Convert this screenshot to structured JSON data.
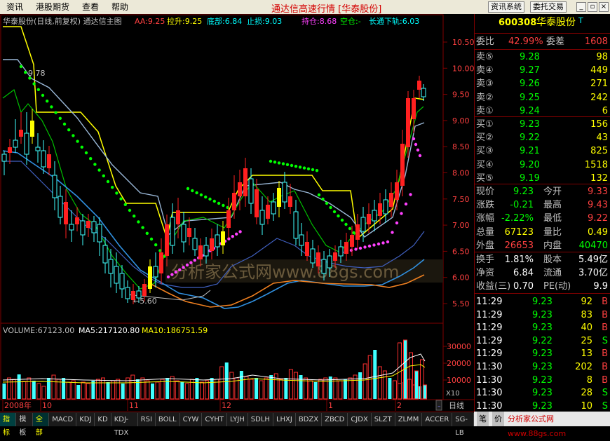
{
  "menu": [
    "资讯",
    "港股期货",
    "查看",
    "帮助"
  ],
  "window_title": "通达信高速行情 [华泰股份]",
  "top_buttons": {
    "news": "资讯系统",
    "trade": "委托交易"
  },
  "chart": {
    "header_main": "华泰股份(日线,前复权) 通达信主图",
    "indicators": [
      {
        "label": "AA:9.25",
        "color": "#ff4040"
      },
      {
        "label": "拉升:9.25",
        "color": "#ffff00"
      },
      {
        "label": "底部:6.84",
        "color": "#00ffff"
      },
      {
        "label": "止损:9.03",
        "color": "#00ffff"
      },
      {
        "label": "持仓:8.68",
        "color": "#ff40ff"
      },
      {
        "label": "空仓:-",
        "color": "#00ff00"
      },
      {
        "label": "长通下轨:6.03",
        "color": "#00ffff"
      }
    ],
    "price_axis": [
      "10.50",
      "10.00",
      "9.50",
      "9.00",
      "8.50",
      "8.00",
      "7.50",
      "7.00",
      "6.50",
      "6.00",
      "5.50"
    ],
    "annot_high": "9.78",
    "annot_low": "←5.60",
    "watermark": "分析家公式网www.88gs.com",
    "volume_header": {
      "vol": "VOLUME:67123.00",
      "ma5": "MA5:217120.80",
      "ma10": "MA10:186751.59"
    },
    "volume_axis": [
      "30000",
      "20000",
      "10000"
    ],
    "volume_unit": "X10",
    "date_labels": [
      "2008年",
      "10",
      "11",
      "12",
      "1",
      "2"
    ],
    "period": "日线"
  },
  "tabs": [
    "指标",
    "模板",
    "全部",
    "MACD",
    "KDJ",
    "KD",
    "KDJ-TDX",
    "RSI",
    "BOLL",
    "CYW",
    "CYHT",
    "LYJH",
    "SDLH",
    "LHXJ",
    "BDZX",
    "ZBCD",
    "CJDX",
    "SLZT",
    "ZLMM",
    "ACCER",
    "SG-LB"
  ],
  "quote": {
    "code": "600308",
    "name": "华泰股份",
    "suffix": "T",
    "ratio_label": "委比",
    "ratio": "42.99%",
    "diff_label": "委差",
    "diff": "1608",
    "asks": [
      {
        "label": "卖⑤",
        "price": "9.28",
        "vol": "98"
      },
      {
        "label": "卖④",
        "price": "9.27",
        "vol": "449"
      },
      {
        "label": "卖③",
        "price": "9.26",
        "vol": "271"
      },
      {
        "label": "卖②",
        "price": "9.25",
        "vol": "242"
      },
      {
        "label": "卖①",
        "price": "9.24",
        "vol": "6"
      }
    ],
    "bids": [
      {
        "label": "买①",
        "price": "9.23",
        "vol": "156"
      },
      {
        "label": "买②",
        "price": "9.22",
        "vol": "43"
      },
      {
        "label": "买③",
        "price": "9.21",
        "vol": "825"
      },
      {
        "label": "买④",
        "price": "9.20",
        "vol": "1518"
      },
      {
        "label": "买⑤",
        "price": "9.19",
        "vol": "132"
      }
    ],
    "stats": [
      {
        "l1": "现价",
        "v1": "9.23",
        "l2": "今开",
        "v2": "9.33"
      },
      {
        "l1": "涨跌",
        "v1": "-0.21",
        "l2": "最高",
        "v2": "9.43"
      },
      {
        "l1": "涨幅",
        "v1": "-2.22%",
        "l2": "最低",
        "v2": "9.22"
      },
      {
        "l1": "总量",
        "v1": "67123",
        "l2": "量比",
        "v2": "0.49"
      },
      {
        "l1": "外盘",
        "v1": "26653",
        "l2": "内盘",
        "v2": "40470"
      }
    ],
    "fin": [
      {
        "l1": "换手",
        "v1": "1.81%",
        "l2": "股本",
        "v2": "5.49亿"
      },
      {
        "l1": "净资",
        "v1": "6.84",
        "l2": "流通",
        "v2": "3.70亿"
      },
      {
        "l1": "收益(三)",
        "v1": "0.70",
        "l2": "PE(动)",
        "v2": "9.9"
      }
    ],
    "ticks": [
      {
        "time": "11:29",
        "price": "9.23",
        "vol": "92",
        "side": "B"
      },
      {
        "time": "11:29",
        "price": "9.23",
        "vol": "83",
        "side": "B"
      },
      {
        "time": "11:29",
        "price": "9.23",
        "vol": "40",
        "side": "B"
      },
      {
        "time": "11:29",
        "price": "9.22",
        "vol": "25",
        "side": "S"
      },
      {
        "time": "11:29",
        "price": "9.23",
        "vol": "13",
        "side": "B"
      },
      {
        "time": "11:30",
        "price": "9.23",
        "vol": "202",
        "side": "B"
      },
      {
        "time": "11:30",
        "price": "9.23",
        "vol": "8",
        "side": "B"
      },
      {
        "time": "11:30",
        "price": "9.23",
        "vol": "28",
        "side": "S"
      },
      {
        "time": "11:30",
        "price": "9.23",
        "vol": "10",
        "side": "S"
      }
    ]
  },
  "bottom_tabs": {
    "b1": "笔",
    "b2": "价"
  },
  "site_credit": "分析家公式网www.88gs.com"
}
